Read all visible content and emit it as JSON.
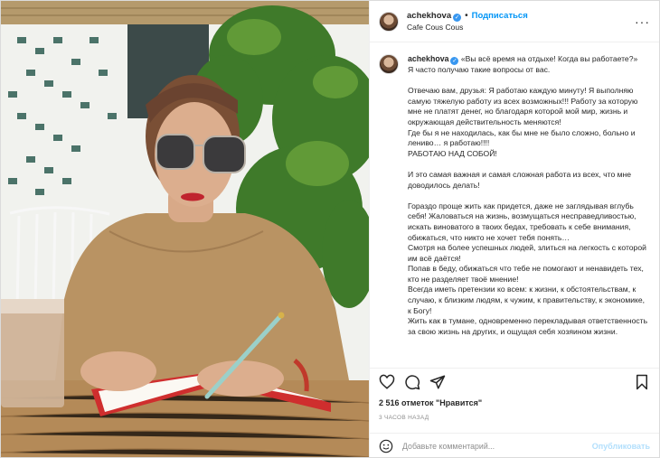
{
  "header": {
    "username": "achekhova",
    "verified_mark": "✓",
    "separator": "•",
    "follow_label": "Подписаться",
    "location": "Cafe Cous Cous",
    "more_glyph": "···"
  },
  "caption": {
    "username": "achekhova",
    "paragraphs": [
      "«Вы всё время на отдыхе! Когда вы работаете?»\nЯ часто получаю такие вопросы от вас.",
      "Отвечаю вам, друзья: Я работаю каждую минуту! Я выполняю самую тяжелую работу из всех возможных!!! Работу за которую мне не платят денег, но благодаря которой мой мир, жизнь и окружающая действительность меняются!\nГде бы я не находилась, как бы мне не было сложно, больно и лениво… я работаю!!!!\nРАБОТАЮ НАД СОБОЙ!",
      "И это самая важная и самая сложная работа из всех, что мне доводилось делать!",
      "Гораздо проще жить как придется, даже не заглядывая вглубь себя! Жаловаться на жизнь, возмущаться несправедливостью, искать виноватого в твоих бедах, требовать к себе внимания, обижаться, что никто не хочет тебя понять…\nСмотря на более успешных людей, злиться на легкость с которой им всё даётся!\nПопав в беду, обижаться что тебе не помогают и ненавидеть тех, кто не разделяет твоё мнение!\nВсегда иметь претензии ко всем: к жизни, к обстоятельствам, к случаю, к близким людям, к чужим, к правительству, к экономике, к Богу!\nЖить как в тумане, одновременно перекладывая ответственность за свою жизнь на других, и ощущая себя хозяином жизни."
    ]
  },
  "actions": {
    "like_icon": "heart-icon",
    "comment_icon": "comment-icon",
    "share_icon": "paper-plane-icon",
    "save_icon": "bookmark-icon"
  },
  "likes_text": "2 516 отметок \"Нравится\"",
  "time_text": "3 ЧАСОВ НАЗАД",
  "comment_box": {
    "placeholder": "Добавьте комментарий...",
    "publish_label": "Опубликовать"
  },
  "colors": {
    "accent": "#0095f6",
    "verified": "#3897f0",
    "publish_disabled": "#b2dffc"
  }
}
